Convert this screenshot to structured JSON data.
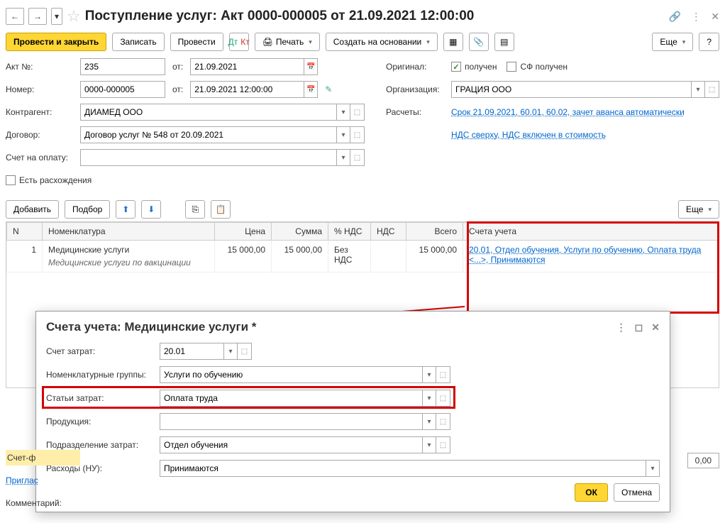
{
  "titlebar": {
    "title": "Поступление услуг: Акт 0000-000005 от 21.09.2021 12:00:00"
  },
  "toolbar": {
    "post_close": "Провести и закрыть",
    "save": "Записать",
    "post": "Провести",
    "print": "Печать",
    "create_based": "Создать на основании",
    "more": "Еще",
    "help": "?"
  },
  "form": {
    "akt_label": "Акт №:",
    "akt_value": "235",
    "ot_label": "от:",
    "akt_date": "21.09.2021",
    "nomer_label": "Номер:",
    "nomer_value": "0000-000005",
    "nomer_date": "21.09.2021 12:00:00",
    "original_label": "Оригинал:",
    "received": "получен",
    "sf_received": "СФ получен",
    "org_label": "Организация:",
    "org_value": "ГРАЦИЯ ООО",
    "contractor_label": "Контрагент:",
    "contractor_value": "ДИАМЕД ООО",
    "raschety_label": "Расчеты:",
    "raschety_link": "Срок 21.09.2021, 60.01, 60.02, зачет аванса автоматически",
    "contract_label": "Договор:",
    "contract_value": "Договор услуг № 548 от 20.09.2021",
    "nds_link": "НДС сверху, НДС включен в стоимость",
    "invoice_label": "Счет на оплату:",
    "diff_label": "Есть расхождения"
  },
  "table_toolbar": {
    "add": "Добавить",
    "select": "Подбор",
    "more": "Еще"
  },
  "table": {
    "headers": {
      "n": "N",
      "nomenclature": "Номенклатура",
      "price": "Цена",
      "sum": "Сумма",
      "vat_pct": "% НДС",
      "vat": "НДС",
      "total": "Всего",
      "accounts": "Счета учета"
    },
    "rows": [
      {
        "n": "1",
        "name": "Медицинские услуги",
        "desc": "Медицинские услуги по вакцинации",
        "price": "15 000,00",
        "sum": "15 000,00",
        "vat_pct": "Без НДС",
        "vat": "",
        "total": "15 000,00",
        "accounts": "20.01, Отдел обучения, Услуги по обучению, Оплата труда <...>, Принимаются"
      }
    ]
  },
  "modal": {
    "title": "Счета учета: Медицинские услуги *",
    "cost_account_label": "Счет затрат:",
    "cost_account": "20.01",
    "nom_group_label": "Номенклатурные группы:",
    "nom_group": "Услуги по обучению",
    "expense_item_label": "Статьи затрат:",
    "expense_item": "Оплата труда",
    "product_label": "Продукция:",
    "product": "",
    "dept_label": "Подразделение затрат:",
    "dept": "Отдел обучения",
    "tax_exp_label": "Расходы (НУ):",
    "tax_exp": "Принимаются",
    "ok": "ОК",
    "cancel": "Отмена"
  },
  "footer": {
    "sf_label": "Счет-ф",
    "priglas": "Приглас",
    "comment_label": "Комментарий:",
    "amount": "0,00"
  }
}
